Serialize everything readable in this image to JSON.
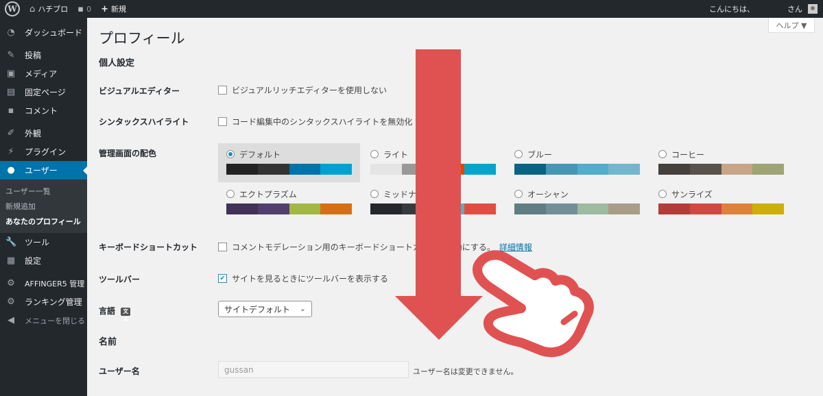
{
  "adminbar": {
    "wp_logo": "W",
    "site_name": "ハチブロ",
    "comments_count": "0",
    "new_label": "新規",
    "greeting": "こんにちは、",
    "user_suffix": "さん",
    "icons": {
      "home": "home-icon",
      "comments": "comment-bubble-icon",
      "new": "plus-icon",
      "avatar": "avatar-icon"
    }
  },
  "sidebar": {
    "items_top": [
      {
        "icon": "ダ",
        "label": "ダッシュボード"
      }
    ],
    "items_mid": [
      {
        "label": "投稿"
      },
      {
        "label": "メディア"
      },
      {
        "label": "固定ページ"
      },
      {
        "label": "コメント"
      }
    ],
    "items_mid2": [
      {
        "label": "外観"
      },
      {
        "label": "プラグイン"
      }
    ],
    "active": {
      "label": "ユーザー"
    },
    "submenu": [
      {
        "label": "ユーザー一覧"
      },
      {
        "label": "新規追加"
      },
      {
        "label": "あなたのプロフィール"
      }
    ],
    "items_bottom": [
      {
        "label": "ツール"
      },
      {
        "label": "設定"
      }
    ],
    "items_plugins": [
      {
        "label": "AFFINGER5 管理"
      },
      {
        "label": "ランキング管理"
      }
    ],
    "collapse_label": "メニューを閉じる"
  },
  "content": {
    "help_label": "ヘルプ ▼",
    "page_title": "プロフィール",
    "section_personal": "個人設定",
    "visual_editor": {
      "label": "ビジュアルエディター",
      "option": "ビジュアルリッチエディターを使用しない",
      "checked": false
    },
    "syntax": {
      "label": "シンタックスハイライト",
      "option": "コード編集中のシンタックスハイライトを無効化",
      "checked": false
    },
    "color_scheme": {
      "label": "管理画面の配色",
      "schemes": [
        {
          "name": "デフォルト",
          "selected": true,
          "colors": [
            "#222222",
            "#333333",
            "#0073aa",
            "#00a0d2"
          ]
        },
        {
          "name": "ライト",
          "selected": false,
          "colors": [
            "#e5e5e5",
            "#999999",
            "#d64e07",
            "#04a4cc"
          ]
        },
        {
          "name": "ブルー",
          "selected": false,
          "colors": [
            "#096484",
            "#4796b3",
            "#52accc",
            "#74b6ce"
          ]
        },
        {
          "name": "コーヒー",
          "selected": false,
          "colors": [
            "#46403c",
            "#59524c",
            "#c7a589",
            "#9ea476"
          ]
        },
        {
          "name": "エクトプラズム",
          "selected": false,
          "colors": [
            "#413256",
            "#523f6d",
            "#a3b745",
            "#d46f15"
          ]
        },
        {
          "name": "ミッドナイト",
          "selected": false,
          "colors": [
            "#25282b",
            "#363b3f",
            "#69a8bb",
            "#e14d43"
          ]
        },
        {
          "name": "オーシャン",
          "selected": false,
          "colors": [
            "#627c83",
            "#738e96",
            "#9ebaa0",
            "#aa9d88"
          ]
        },
        {
          "name": "サンライズ",
          "selected": false,
          "colors": [
            "#b43c38",
            "#cf4944",
            "#dd823b",
            "#ccaf0b"
          ]
        }
      ]
    },
    "shortcuts": {
      "label": "キーボードショートカット",
      "option": "コメントモデレーション用のキーボードショートカットを有効にする。",
      "link": "詳細情報",
      "checked": false
    },
    "toolbar": {
      "label": "ツールバー",
      "option": "サイトを見るときにツールバーを表示する",
      "checked": true
    },
    "language": {
      "label": "言語",
      "icon_text": "文A",
      "selected": "サイトデフォルト"
    },
    "section_name": "名前",
    "username": {
      "label": "ユーザー名",
      "value": "gussan",
      "hint": "ユーザー名は変更できません。"
    }
  },
  "overlay": {
    "arrow_color": "#e05252",
    "hand_color": "#e05252",
    "arrow_icon": "down-arrow-icon",
    "hand_icon": "pointing-hand-icon"
  }
}
